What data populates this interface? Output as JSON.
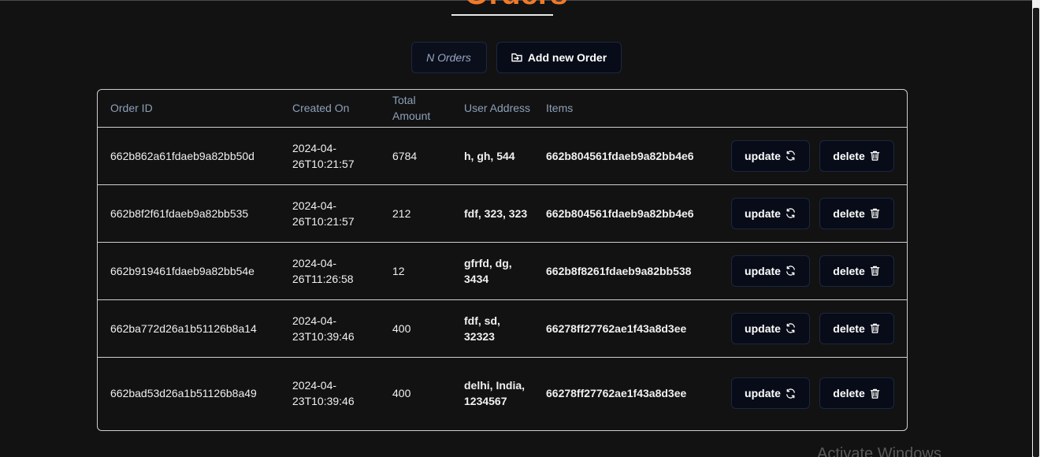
{
  "page": {
    "title": "Orders",
    "accent_color": "#f07a2a"
  },
  "toolbar": {
    "count_label": "N Orders",
    "add_label": "Add new Order",
    "add_icon": "file-import-icon"
  },
  "table": {
    "headers": {
      "order_id": "Order ID",
      "created_on": "Created On",
      "total_amount": "Total Amount",
      "user_address": "User Address",
      "items": "Items"
    },
    "rows": [
      {
        "order_id": "662b862a61fdaeb9a82bb50d",
        "created_on": "2024-04-26T10:21:57",
        "total_amount": "6784",
        "user_address": "h, gh, 544",
        "items": "662b804561fdaeb9a82bb4e6",
        "update": "update",
        "delete": "delete"
      },
      {
        "order_id": "662b8f2f61fdaeb9a82bb535",
        "created_on": "2024-04-26T10:21:57",
        "total_amount": "212",
        "user_address": "fdf, 323, 323",
        "items": "662b804561fdaeb9a82bb4e6",
        "update": "update",
        "delete": "delete"
      },
      {
        "order_id": "662b919461fdaeb9a82bb54e",
        "created_on": "2024-04-26T11:26:58",
        "total_amount": "12",
        "user_address": "gfrfd, dg, 3434",
        "items": "662b8f8261fdaeb9a82bb538",
        "update": "update",
        "delete": "delete"
      },
      {
        "order_id": "662ba772d26a1b51126b8a14",
        "created_on": "2024-04-23T10:39:46",
        "total_amount": "400",
        "user_address": "fdf, sd, 32323",
        "items": "66278ff27762ae1f43a8d3ee",
        "update": "update",
        "delete": "delete"
      },
      {
        "order_id": "662bad53d26a1b51126b8a49",
        "created_on": "2024-04-23T10:39:46",
        "total_amount": "400",
        "user_address": "delhi, India, 1234567",
        "items": "66278ff27762ae1f43a8d3ee",
        "update": "update",
        "delete": "delete"
      }
    ]
  },
  "watermark": {
    "text": "Activate Windows"
  }
}
